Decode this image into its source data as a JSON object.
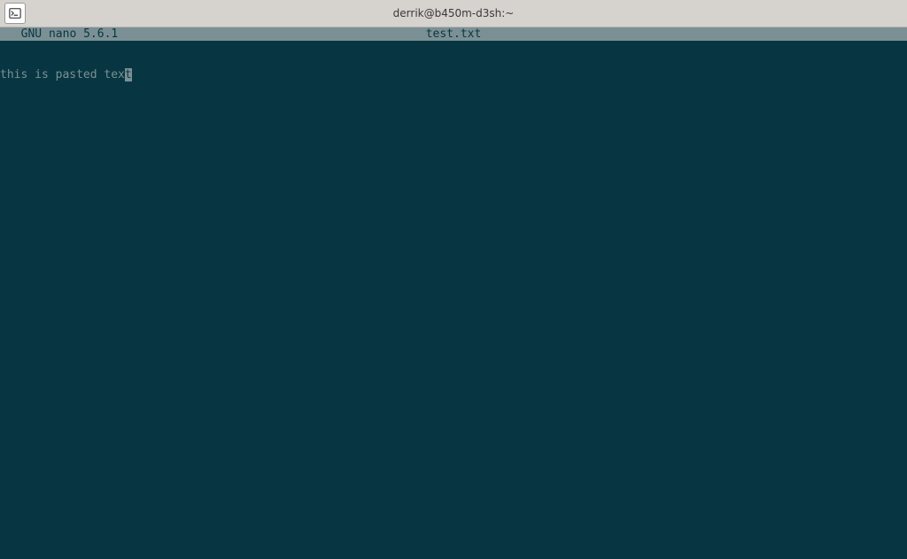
{
  "titlebar": {
    "title": "derrik@b450m-d3sh:~"
  },
  "nano": {
    "app_name": "  GNU nano 5.6.1",
    "filename": "test.txt",
    "content_pre_cursor": "this is pasted tex",
    "cursor_char": "t"
  }
}
